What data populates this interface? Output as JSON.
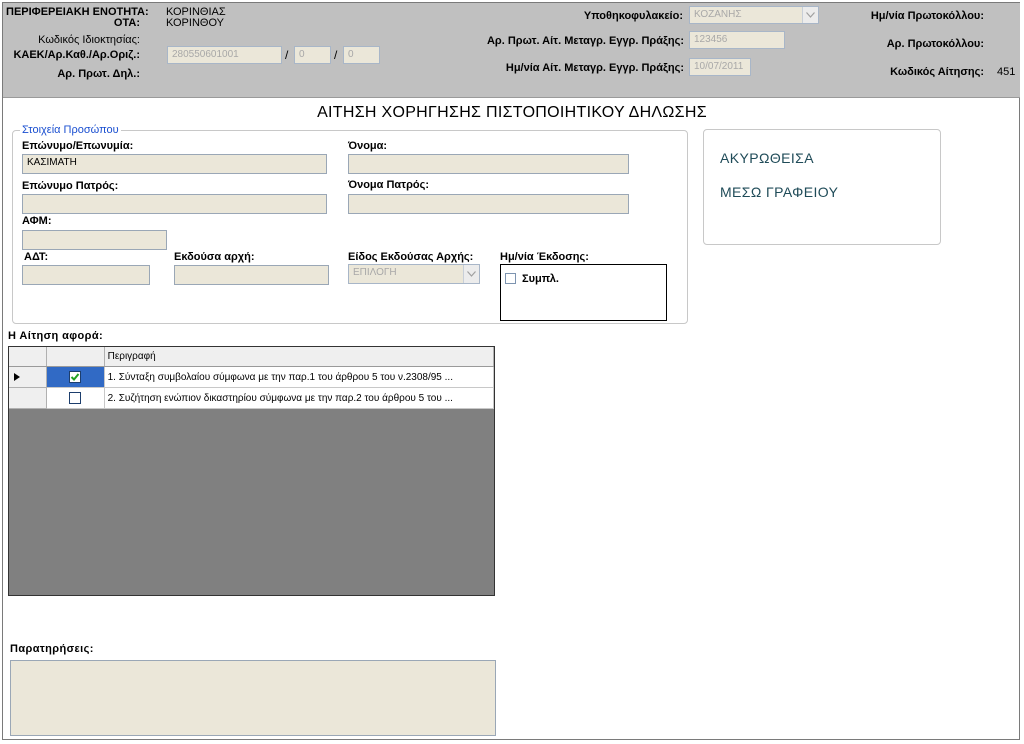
{
  "header": {
    "region_label": "ΠΕΡΙΦΕΡΕΙΑΚΗ ΕΝΟΤΗΤΑ:",
    "region_value": "ΚΟΡΙΝΘΙΑΣ",
    "ota_label": "ΟΤΑ:",
    "ota_value": "ΚΟΡΙΝΘΟΥ",
    "property_code_label": "Κωδικός Ιδιοκτησίας:",
    "kaek_label": "ΚΑΕΚ/Αρ.Καθ./Αρ.Οριζ.:",
    "kaek_value": "280550601001",
    "kaek_part2": "0",
    "kaek_part3": "0",
    "slash": "/",
    "declaration_no_label": "Αρ. Πρωτ. Δηλ.:",
    "mortgage_office_label": "Υποθηκοφυλακείο:",
    "mortgage_office_value": "ΚΟΖΑΝΗΣ",
    "transfer_no_label": "Αρ. Πρωτ. Αίτ. Μεταγρ. Εγγρ. Πράξης:",
    "transfer_no_value": "123456",
    "transfer_date_label": "Ημ/νία Αίτ. Μεταγρ. Εγγρ. Πράξης:",
    "transfer_date_value": "10/07/2011",
    "protocol_date_label": "Ημ/νία Πρωτοκόλλου:",
    "protocol_no_label": "Αρ. Πρωτοκόλλου:",
    "application_code_label": "Κωδικός Αίτησης:",
    "application_code_value": "451"
  },
  "form_title": "ΑΙΤΗΣΗ ΧΟΡΗΓΗΣΗΣ ΠΙΣΤΟΠΟΙΗΤΙΚΟΥ ΔΗΛΩΣΗΣ",
  "person": {
    "legend": "Στοιχεία Προσώπου",
    "surname_label": "Επώνυμο/Επωνυμία:",
    "surname_value": "ΚΑΣΙΜΑΤΗ",
    "name_label": "Όνομα:",
    "father_surname_label": "Επώνυμο Πατρός:",
    "father_name_label": "Όνομα Πατρός:",
    "afm_label": "ΑΦΜ:",
    "adt_label": "ΑΔΤ:",
    "issuer_label": "Εκδούσα αρχή:",
    "issuer_type_label": "Είδος Εκδούσας Αρχής:",
    "issuer_type_value": "ΕΠΙΛΟΓΗ",
    "issue_date_label": "Ημ/νία Έκδοσης:",
    "issue_date_checkbox_label": "Συμπλ."
  },
  "status": {
    "line1": "ΑΚΥΡΩΘΕΙΣΑ",
    "line2": "ΜΕΣΩ ΓΡΑΦΕΙΟΥ"
  },
  "request": {
    "label": "Η Αίτηση αφορά:",
    "column_header": "Περιγραφή",
    "rows": [
      {
        "checked": true,
        "text": "1. Σύνταξη συμβολαίου σύμφωνα με την παρ.1 του άρθρου 5 του ν.2308/95 ..."
      },
      {
        "checked": false,
        "text": "2. Συζήτηση ενώπιον δικαστηρίου σύμφωνα με την παρ.2 του άρθρου 5 του ..."
      }
    ]
  },
  "notes": {
    "label": "Παρατηρήσεις:"
  },
  "colors": {
    "header_bg": "#c0c0c0",
    "field_bg": "#ebe7d9",
    "legend_blue": "#1a4fd0",
    "status_text": "#1f4b58",
    "grid_bg": "#808080",
    "selection": "#316ac5"
  }
}
